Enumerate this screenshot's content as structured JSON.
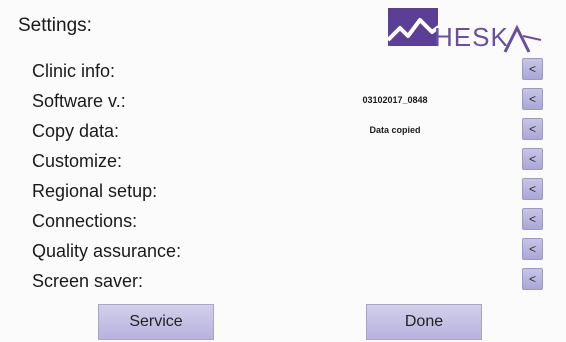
{
  "header": {
    "title": "Settings:",
    "logo_text": "HESK",
    "brand_color": "#6a4fa0"
  },
  "menu": [
    {
      "label": "Clinic info:",
      "value": "",
      "arrow": "<"
    },
    {
      "label": "Software v.:",
      "value": "03102017_0848",
      "arrow": "<"
    },
    {
      "label": "Copy data:",
      "value": "Data copied",
      "arrow": "<"
    },
    {
      "label": "Customize:",
      "value": "",
      "arrow": "<"
    },
    {
      "label": "Regional setup:",
      "value": "",
      "arrow": "<"
    },
    {
      "label": "Connections:",
      "value": "",
      "arrow": "<"
    },
    {
      "label": "Quality assurance:",
      "value": "",
      "arrow": "<"
    },
    {
      "label": "Screen saver:",
      "value": "",
      "arrow": "<"
    }
  ],
  "footer": {
    "service_label": "Service",
    "done_label": "Done"
  },
  "colors": {
    "button_fill": "#c5c1e4",
    "button_border": "#a9a4d3"
  }
}
